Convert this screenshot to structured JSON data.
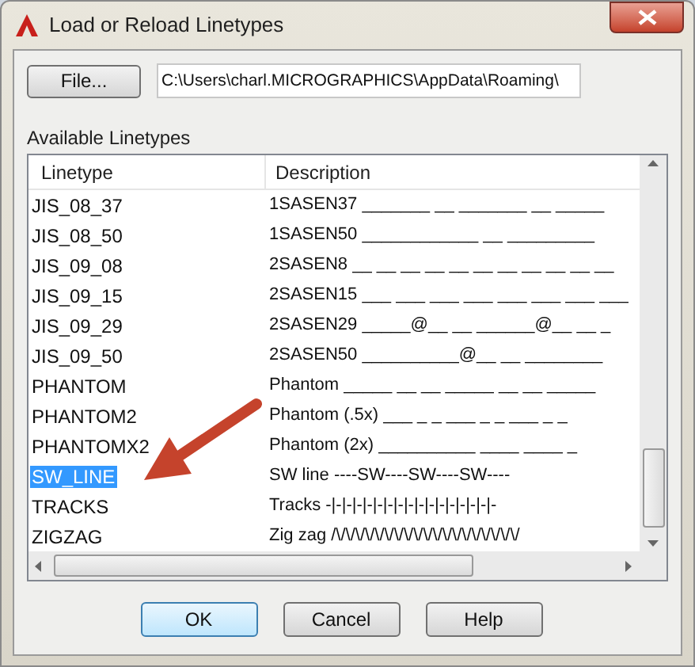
{
  "window": {
    "title": "Load or Reload Linetypes"
  },
  "file_button": "File...",
  "file_path": {
    "value": "C:\\Users\\charl.MICROGRAPHICS\\AppData\\Roaming\\"
  },
  "list_label": "Available Linetypes",
  "table": {
    "columns": [
      "Linetype",
      "Description"
    ],
    "rows": [
      {
        "name": "JIS_08_37",
        "description": "1SASEN37 _______ __ _______ __ _____",
        "selected": false
      },
      {
        "name": "JIS_08_50",
        "description": "1SASEN50 ____________ __ _________",
        "selected": false
      },
      {
        "name": "JIS_09_08",
        "description": "2SASEN8 __ __ __ __ __ __ __ __ __ __ __",
        "selected": false
      },
      {
        "name": "JIS_09_15",
        "description": "2SASEN15 ___ ___ ___ ___ ___ ___ ___ ___",
        "selected": false
      },
      {
        "name": "JIS_09_29",
        "description": "2SASEN29 _____@__ __ ______@__ __ _",
        "selected": false
      },
      {
        "name": "JIS_09_50",
        "description": "2SASEN50 __________@__ __ ________",
        "selected": false
      },
      {
        "name": "PHANTOM",
        "description": "Phantom _____ __ __ _____ __ __ _____",
        "selected": false
      },
      {
        "name": "PHANTOM2",
        "description": "Phantom (.5x) ___ _ _ ___ _ _ ___ _ _",
        "selected": false
      },
      {
        "name": "PHANTOMX2",
        "description": "Phantom (2x) __________   ____   ____   _",
        "selected": false
      },
      {
        "name": "SW_LINE",
        "description": "SW line ----SW----SW----SW----",
        "selected": true
      },
      {
        "name": "TRACKS",
        "description": "Tracks -|-|-|-|-|-|-|-|-|-|-|-|-|-|-|-|-",
        "selected": false
      },
      {
        "name": "ZIGZAG",
        "description": "Zig zag /\\/\\/\\/\\/\\/\\/\\/\\/\\/\\/\\/\\/\\/\\/\\/\\/\\/\\/\\/",
        "selected": false
      }
    ]
  },
  "buttons": [
    {
      "label": "OK",
      "kind": "default"
    },
    {
      "label": "Cancel",
      "kind": "normal"
    },
    {
      "label": "Help",
      "kind": "normal"
    }
  ]
}
